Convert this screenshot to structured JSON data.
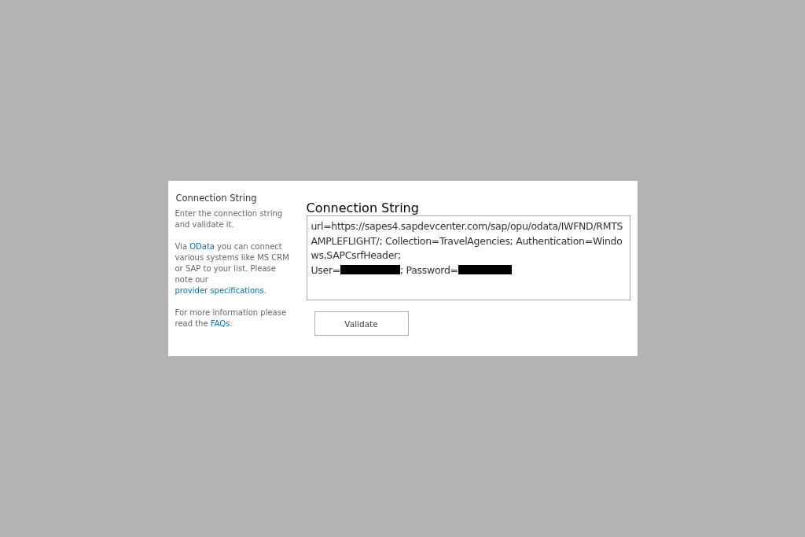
{
  "sidebar": {
    "title": "Connection String",
    "paragraphs": [
      [
        {
          "kind": "text",
          "text": "Enter the connection string and validate it."
        }
      ],
      [
        {
          "kind": "text",
          "text": "Via "
        },
        {
          "kind": "link",
          "text": "OData"
        },
        {
          "kind": "text",
          "text": " you can connect various systems like MS CRM or SAP to your list. Please note our "
        },
        {
          "kind": "link",
          "text": "provider specifications"
        },
        {
          "kind": "text",
          "text": "."
        }
      ],
      [
        {
          "kind": "text",
          "text": "For more information please read the "
        },
        {
          "kind": "link",
          "text": "FAQs"
        },
        {
          "kind": "text",
          "text": "."
        }
      ]
    ]
  },
  "field": {
    "label": "Connection String",
    "value": [
      "url=https://sapes4.sapdevcenter.com/sap/opu/odata/IWFND/RMTSAMPLEFLIGHT/; Collection=TravelAgencies; Authentication=Windows,SAPCsrfHeader;",
      [
        {
          "kind": "text",
          "text": "User="
        },
        {
          "kind": "redacted"
        },
        {
          "kind": "text",
          "text": "; Password="
        },
        {
          "kind": "redacted"
        }
      ]
    ]
  },
  "buttons": [
    {
      "label": "Validate"
    }
  ]
}
